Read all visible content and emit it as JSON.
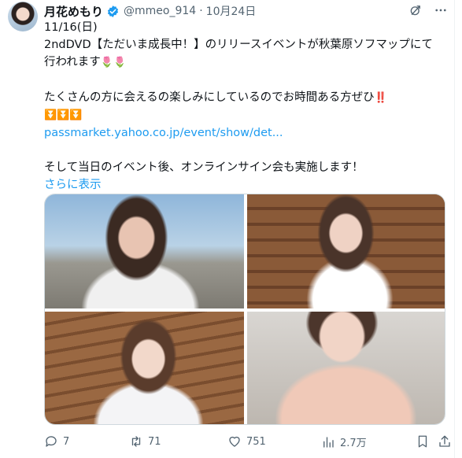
{
  "author": {
    "display_name": "月花めもり",
    "handle": "@mmeo_914",
    "separator": "·",
    "date": "10月24日"
  },
  "tweet": {
    "line_1": "11/16(日)",
    "line_2": "2ndDVD【ただいま成長中！】のリリースイベントが秋葉原ソフマップにて",
    "line_3": "行われます",
    "line_3_emoji": "🌷🌷",
    "line_4": "たくさんの方に会えるの楽しみにしているのでお時間ある方ぜひ",
    "line_4_emoji": "‼️",
    "arrows": "⏬⏬⏬",
    "link": "passmarket.yahoo.co.jp/event/show/det...",
    "line_5": "そして当日のイベント後、オンラインサイン会も実施します！",
    "show_more": "さらに表示"
  },
  "media": {
    "photo_count": 4
  },
  "stats": {
    "replies": "7",
    "reposts": "71",
    "likes": "751",
    "views": "2.7万"
  },
  "colors": {
    "link": "#1d9bf0",
    "secondary_text": "#536471",
    "verified": "#1d9bf0"
  },
  "icons": [
    "verified-icon",
    "grok-icon",
    "more-icon",
    "reply-icon",
    "repost-icon",
    "like-icon",
    "views-icon",
    "bookmark-icon",
    "share-icon"
  ]
}
